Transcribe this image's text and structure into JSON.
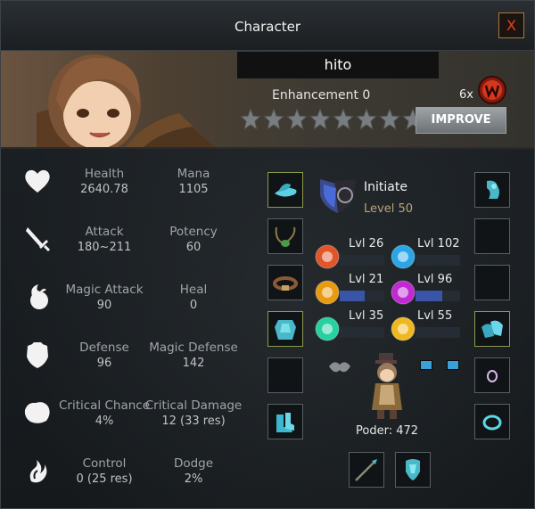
{
  "window": {
    "title": "Character",
    "close_label": "X"
  },
  "banner": {
    "name": "hito",
    "enhancement_label": "Enhancement 0",
    "stars_total": 8,
    "stars_filled": 0,
    "improve_label": "IMPROVE",
    "currency_count": "6x"
  },
  "stats": [
    {
      "label": "Health",
      "value": "2640.78"
    },
    {
      "label": "Mana",
      "value": "1105"
    },
    {
      "label": "Attack",
      "value": "180~211"
    },
    {
      "label": "Potency",
      "value": "60"
    },
    {
      "label": "Magic Attack",
      "value": "90"
    },
    {
      "label": "Heal",
      "value": "0"
    },
    {
      "label": "Defense",
      "value": "96"
    },
    {
      "label": "Magic Defense",
      "value": "142"
    },
    {
      "label": "Critical Chance",
      "value": "4%"
    },
    {
      "label": "Critical Damage",
      "value": "12 (33 res)"
    },
    {
      "label": "Control",
      "value": "0 (25 res)"
    },
    {
      "label": "Dodge",
      "value": "2%"
    }
  ],
  "stat_icons": [
    "heart-icon",
    "sword-icon",
    "fireball-icon",
    "shield-icon",
    "critical-icon",
    "control-icon"
  ],
  "rank": {
    "name": "Initiate",
    "level": "Level 50"
  },
  "elements": [
    {
      "icon": "fire-element-icon",
      "label": "Lvl 26",
      "color": "#e0552a",
      "fill": 0.0
    },
    {
      "icon": "water-element-icon",
      "label": "Lvl 102",
      "color": "#2aa6e6",
      "fill": 0.0
    },
    {
      "icon": "earth-element-icon",
      "label": "Lvl 21",
      "color": "#e89a12",
      "fill": 0.55
    },
    {
      "icon": "arcane-element-icon",
      "label": "Lvl 96",
      "color": "#c02ad2",
      "fill": 0.6
    },
    {
      "icon": "wind-element-icon",
      "label": "Lvl 35",
      "color": "#26d0a0",
      "fill": 0.0
    },
    {
      "icon": "light-element-icon",
      "label": "Lvl 55",
      "color": "#f0b820",
      "fill": 0.0
    }
  ],
  "equipment": {
    "left": [
      "hat-icon",
      "necklace-icon",
      "belt-icon",
      "armor-icon",
      "empty",
      "boots-icon"
    ],
    "right": [
      "shoulder-armor-icon",
      "empty",
      "empty",
      "gloves-icon",
      "ring-icon",
      "bracelet-icon"
    ],
    "bottom": [
      "weapon-icon",
      "offhand-icon"
    ]
  },
  "poder": "Poder: 472",
  "colors": {
    "accent": "#3a55a8",
    "gold": "#b9a27a",
    "close": "#e8421e"
  }
}
